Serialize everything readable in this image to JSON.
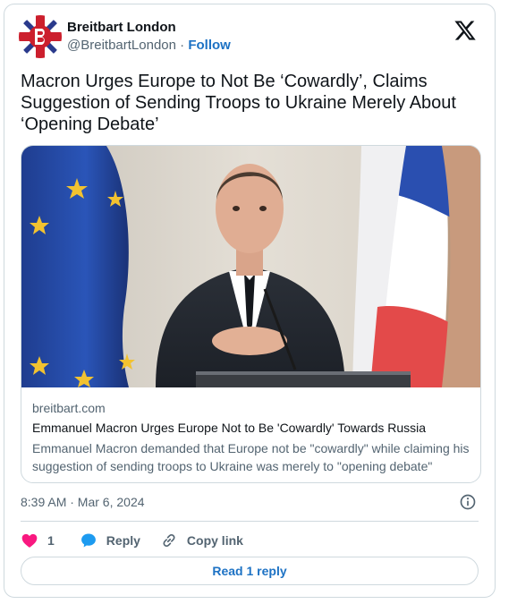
{
  "account": {
    "display_name": "Breitbart London",
    "handle": "@BreitbartLondon",
    "separator": "·",
    "follow_label": "Follow",
    "brand_color": "#cc1f2d"
  },
  "tweet": {
    "text": "Macron Urges Europe to Not Be ‘Cowardly’, Claims Suggestion of Sending Troops to Ukraine Merely About ‘Opening Debate’"
  },
  "link_card": {
    "domain": "breitbart.com",
    "title": "Emmanuel Macron Urges Europe Not to Be 'Cowardly' Towards Russia",
    "description": "Emmanuel Macron demanded that Europe not be \"cowardly\" while claiming his suggestion of sending troops to Ukraine was merely to \"opening debate\"",
    "image_icon": "photo-macron-podium"
  },
  "meta": {
    "timestamp": "8:39 AM · Mar 6, 2024"
  },
  "actions": {
    "like_count": "1",
    "reply_label": "Reply",
    "copy_link_label": "Copy link",
    "like_color": "#f91880",
    "reply_color": "#1d9bf0"
  },
  "read_reply_label": "Read 1 reply",
  "icons": {
    "brand": "x-logo-icon",
    "info": "info-icon",
    "like": "heart-icon",
    "reply": "speech-bubble-icon",
    "copy": "link-icon"
  }
}
